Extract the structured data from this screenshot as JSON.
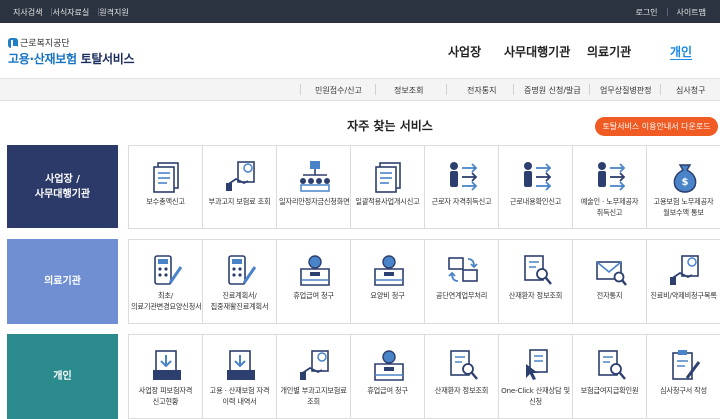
{
  "topbar": {
    "left": [
      "지사검색",
      "서식자료실",
      "원격지원"
    ],
    "right": [
      "로그인",
      "사이트맵"
    ]
  },
  "logo": {
    "org": "근로복지공단",
    "svc_blue": "고용·산재보험",
    "svc_rest": " 토탈서비스"
  },
  "gnb": [
    "사업장",
    "사무대행기관",
    "의료기관",
    "개인"
  ],
  "subnav": [
    "민원접수/신고",
    "정보조회",
    "전자통지",
    "증명원 신청/발급",
    "업무상질병판정",
    "심사청구"
  ],
  "section_title": "자주 찾는 서비스",
  "download_button": "토탈서비스 이용안내서 다운로드",
  "colors": {
    "topbar": "#2b3240",
    "accent_orange": "#f05a23",
    "row1_label": "#2b3a68",
    "row2_label": "#6f8fd2",
    "row3_label": "#2a8a8c",
    "icon_dark": "#2d3f6e",
    "icon_blue": "#4a84c8",
    "active_nav": "#1a8ae6"
  },
  "rows": [
    {
      "label_lines": [
        "사업장 /",
        "사무대행기관"
      ],
      "tiles": [
        {
          "icon": "document-stack-icon",
          "label": "보수총액신고"
        },
        {
          "icon": "hand-document-icon",
          "label": "부과고지 보험료 조회"
        },
        {
          "icon": "org-chart-icon",
          "label": "일자리안정자금신청화면안내"
        },
        {
          "icon": "document-stack-icon",
          "label": "일괄적용사업개시신고"
        },
        {
          "icon": "person-arrows-icon",
          "label": "근로자 자격취득신고"
        },
        {
          "icon": "person-arrows-icon",
          "label": "근로내용확인신고"
        },
        {
          "icon": "person-arrows-icon",
          "label": "예술인 · 노무제공자 취득신고"
        },
        {
          "icon": "money-bag-icon",
          "label": "고용보험 노무제공자 월보수액 통보"
        }
      ]
    },
    {
      "label_lines": [
        "의료기관"
      ],
      "tiles": [
        {
          "icon": "calculator-pen-icon",
          "label": "최초/의료기관변경요양신청서"
        },
        {
          "icon": "calculator-pen-icon",
          "label": "진료계획서/집중재활진료계획서"
        },
        {
          "icon": "coin-box-icon",
          "label": "휴업급여 청구"
        },
        {
          "icon": "coin-box-icon",
          "label": "요양비 청구"
        },
        {
          "icon": "monitor-exchange-icon",
          "label": "공단연계업무처리"
        },
        {
          "icon": "document-search-icon",
          "label": "산재환자 정보조회"
        },
        {
          "icon": "envelope-search-icon",
          "label": "전자통지"
        },
        {
          "icon": "hand-document-icon",
          "label": "진료비/약제비청구목록"
        }
      ]
    },
    {
      "label_lines": [
        "개인"
      ],
      "tiles": [
        {
          "icon": "box-download-icon",
          "label": "사업장 피보험자격 신고현황"
        },
        {
          "icon": "box-download-icon",
          "label": "고용 · 산재보험 자격 이력 내역서"
        },
        {
          "icon": "hand-document-icon",
          "label": "개인별 부과고지보험료 조회"
        },
        {
          "icon": "coin-box-icon",
          "label": "휴업급여 청구"
        },
        {
          "icon": "document-search-icon",
          "label": "산재환자 정보조회"
        },
        {
          "icon": "click-document-icon",
          "label": "One-Click 산재상담 및 신청"
        },
        {
          "icon": "document-search-icon",
          "label": "보험급여지급확인원"
        },
        {
          "icon": "clipboard-pen-icon",
          "label": "심사청구서 작성"
        }
      ]
    }
  ]
}
